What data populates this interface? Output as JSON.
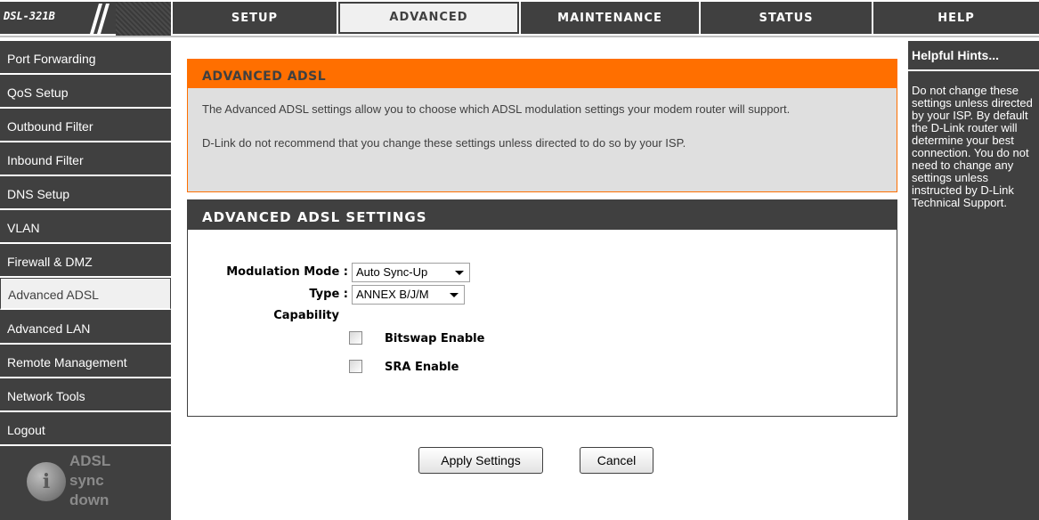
{
  "brand": {
    "model": "DSL-321B"
  },
  "nav": {
    "tabs": [
      {
        "label": "SETUP"
      },
      {
        "label": "ADVANCED"
      },
      {
        "label": "MAINTENANCE"
      },
      {
        "label": "STATUS"
      },
      {
        "label": "HELP"
      }
    ],
    "active_tab": "ADVANCED"
  },
  "sidebar": {
    "items": [
      {
        "label": "Port Forwarding"
      },
      {
        "label": "QoS Setup"
      },
      {
        "label": "Outbound Filter"
      },
      {
        "label": "Inbound Filter"
      },
      {
        "label": "DNS Setup"
      },
      {
        "label": "VLAN"
      },
      {
        "label": "Firewall & DMZ"
      },
      {
        "label": "Advanced ADSL"
      },
      {
        "label": "Advanced LAN"
      },
      {
        "label": "Remote Management"
      },
      {
        "label": "Network Tools"
      },
      {
        "label": "Logout"
      }
    ],
    "active_item": "Advanced ADSL",
    "sync_status": {
      "line1": "ADSL",
      "line2": "sync",
      "line3": "down",
      "icon": "info-icon"
    }
  },
  "intro": {
    "title": "ADVANCED ADSL",
    "paragraph1": "The Advanced ADSL settings allow you to choose which ADSL modulation settings your modem router will support.",
    "paragraph2": "D-Link do not recommend that you change these settings unless directed to do so by your ISP."
  },
  "settings": {
    "title": "ADVANCED ADSL SETTINGS",
    "modulation_mode": {
      "label": "Modulation Mode :",
      "value": "Auto Sync-Up"
    },
    "type": {
      "label": "Type :",
      "value": "ANNEX B/J/M"
    },
    "capability_label": "Capability",
    "bitswap": {
      "label": "Bitswap Enable",
      "checked": false
    },
    "sra": {
      "label": "SRA Enable",
      "checked": false
    }
  },
  "actions": {
    "apply_label": "Apply Settings",
    "cancel_label": "Cancel"
  },
  "help": {
    "title": "Helpful Hints...",
    "text": "Do not change these settings unless directed by your ISP. By default the D-Link router will determine your best connection. You do not need to change any settings unless instructed by D-Link Technical Support."
  },
  "colors": {
    "dark_gray": "#404040",
    "accent_orange": "#ff6f00",
    "light_panel": "#dfdfdf",
    "active_bg": "#f0f0f0"
  }
}
